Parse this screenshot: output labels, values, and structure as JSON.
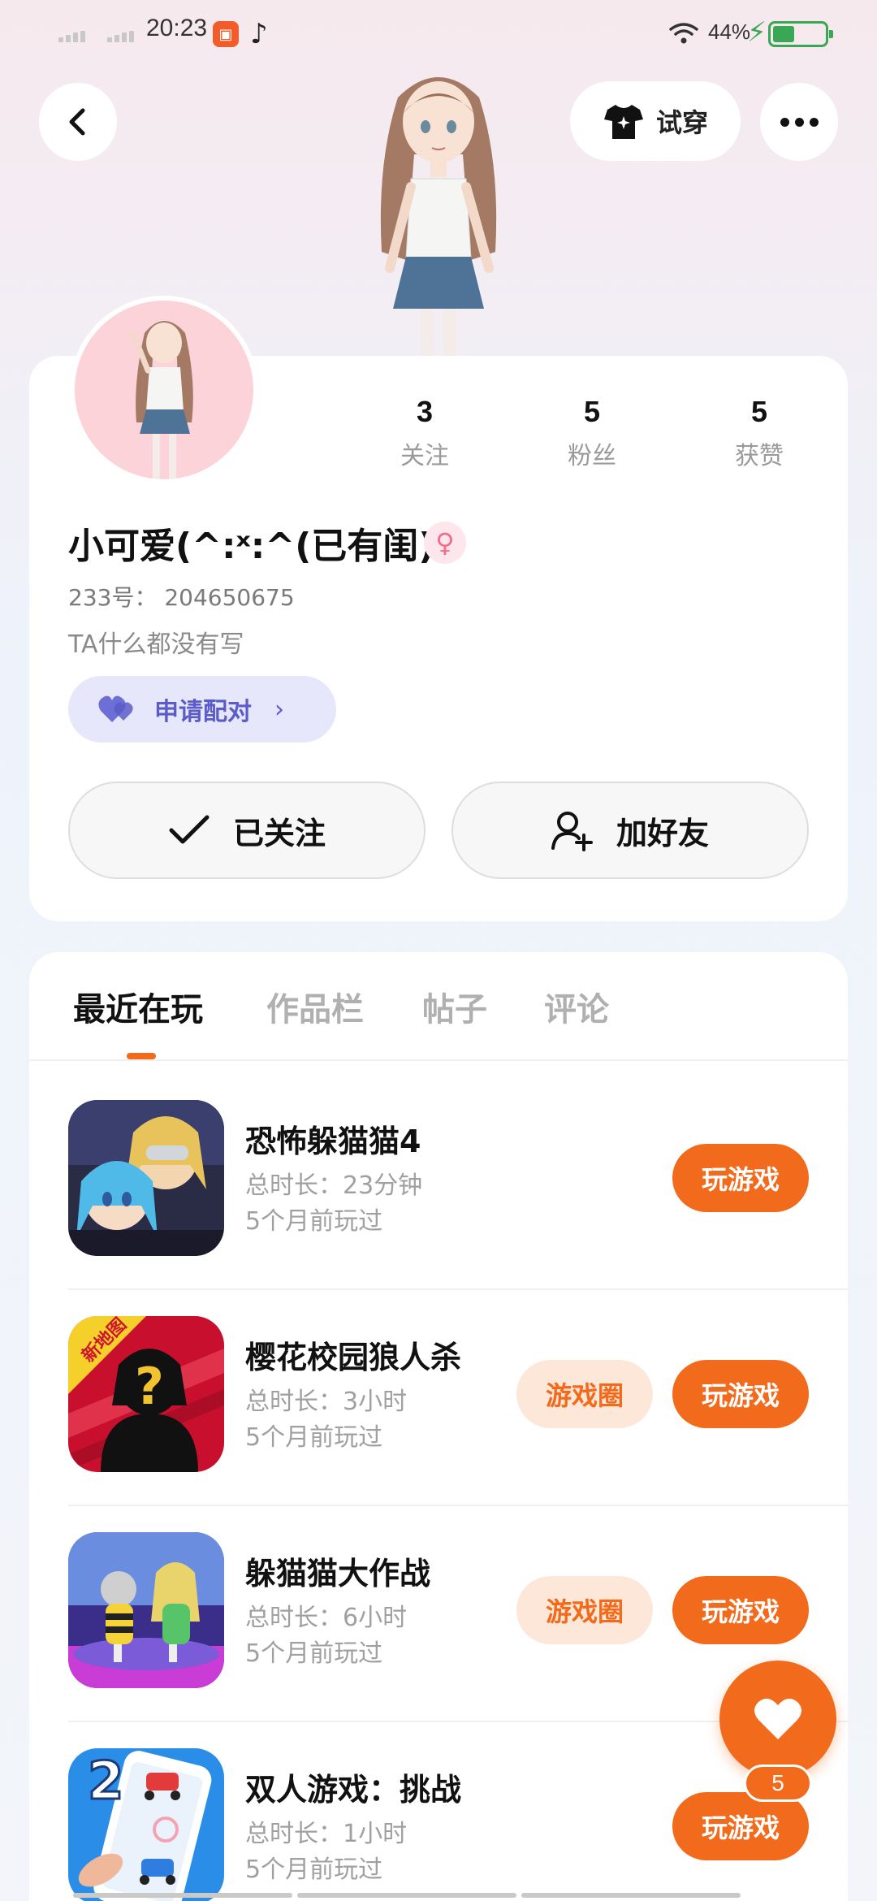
{
  "status_bar": {
    "time": "20:23",
    "battery_percent": "44%",
    "battery_level": 0.44
  },
  "top_bar": {
    "try_on_label": "试穿"
  },
  "profile": {
    "stats": [
      {
        "value": "3",
        "label": "关注"
      },
      {
        "value": "5",
        "label": "粉丝"
      },
      {
        "value": "5",
        "label": "获赞"
      }
    ],
    "nickname": "小可爱(^:ˣ:^(已有闺)",
    "gender_symbol": "♀",
    "uid_line": "233号： 204650675",
    "bio": "TA什么都没有写",
    "pair_label": "申请配对",
    "followed_label": "已关注",
    "add_friend_label": "加好友"
  },
  "tabs": [
    {
      "label": "最近在玩",
      "active": true
    },
    {
      "label": "作品栏",
      "active": false
    },
    {
      "label": "帖子",
      "active": false
    },
    {
      "label": "评论",
      "active": false
    }
  ],
  "games": [
    {
      "title": "恐怖躲猫猫4",
      "duration": "总时长：23分钟",
      "last_played": "5个月前玩过",
      "has_circle": false,
      "play_label": "玩游戏",
      "circle_label": ""
    },
    {
      "title": "樱花校园狼人杀",
      "duration": "总时长：3小时",
      "last_played": "5个月前玩过",
      "has_circle": true,
      "play_label": "玩游戏",
      "circle_label": "游戏圈",
      "badge": "新地图"
    },
    {
      "title": "躲猫猫大作战",
      "duration": "总时长：6小时",
      "last_played": "5个月前玩过",
      "has_circle": true,
      "play_label": "玩游戏",
      "circle_label": "游戏圈"
    },
    {
      "title": "双人游戏：挑战",
      "duration": "总时长：1小时",
      "last_played": "5个月前玩过",
      "has_circle": false,
      "play_label": "玩游戏",
      "circle_label": ""
    }
  ],
  "like_fab": {
    "count": "5"
  },
  "colors": {
    "accent": "#f26a1b",
    "pair_accent": "#5b5cc8",
    "gender": "#f26c8c"
  }
}
